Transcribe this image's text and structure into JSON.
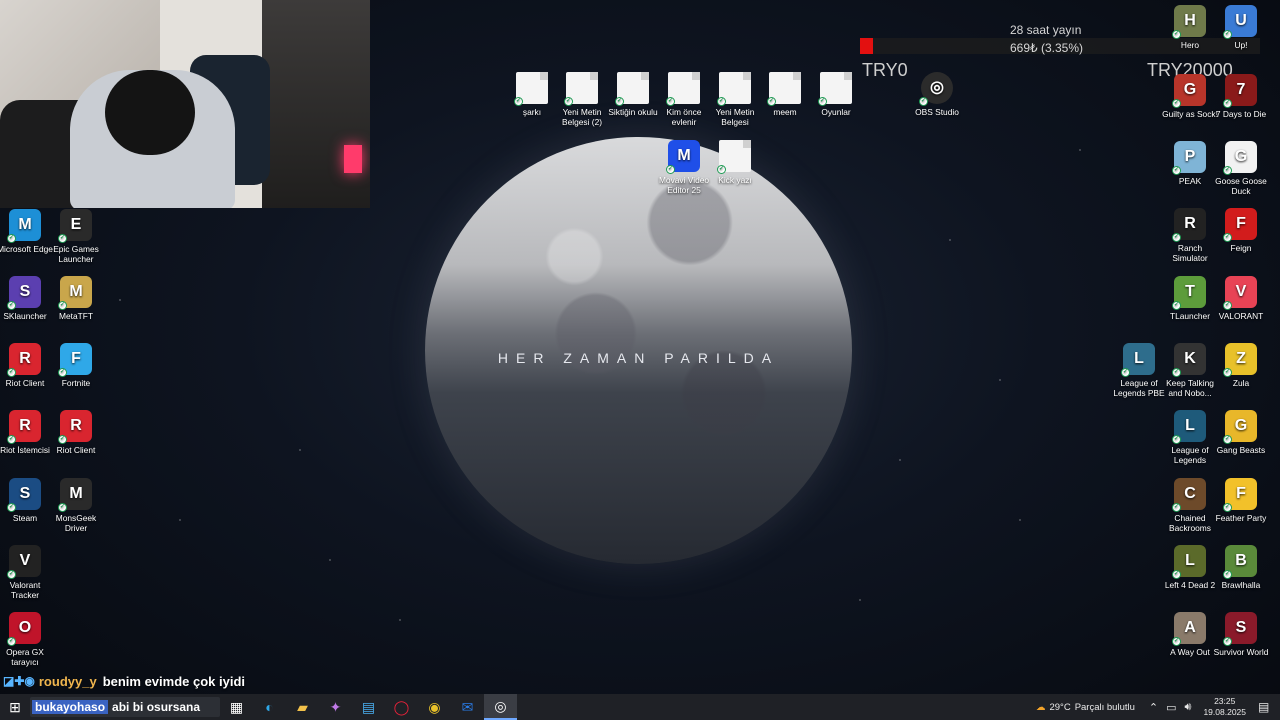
{
  "wallpaper": {
    "slogan": "HER ZAMAN PARILDA"
  },
  "overlay": {
    "subtitle": "28 saat yayın",
    "progress_text": "669₺ (3.35%)",
    "progress_fraction": 0.0335,
    "min_label": "TRY0",
    "max_label": "TRY20000",
    "bar_color": "#e31010"
  },
  "desktop": {
    "top_files": [
      {
        "label": "şarkı",
        "icon": "document-icon"
      },
      {
        "label": "Yeni Metin Belgesi (2)",
        "icon": "document-icon"
      },
      {
        "label": "Siktiğin okulu",
        "icon": "document-icon"
      },
      {
        "label": "Kim önce evlenir",
        "icon": "document-icon"
      },
      {
        "label": "Yeni Metin Belgesi",
        "icon": "document-icon"
      },
      {
        "label": "meem",
        "icon": "document-icon"
      },
      {
        "label": "Oyunlar",
        "icon": "document-icon"
      },
      {
        "label": "OBS Studio",
        "icon": "obs-icon"
      }
    ],
    "second_row_files": [
      {
        "label": "Movavi Video Editor 25",
        "icon": "movavi-icon"
      },
      {
        "label": "Kick yazı",
        "icon": "document-icon"
      }
    ],
    "left_icons": [
      {
        "label": "Microsoft Edge",
        "icon": "edge-icon",
        "color": "#1d8fd6"
      },
      {
        "label": "Epic Games Launcher",
        "icon": "epic-icon",
        "color": "#2a2a2a"
      },
      {
        "label": "SKlauncher",
        "icon": "sklauncher-icon",
        "color": "#5b3fb0"
      },
      {
        "label": "MetaTFT",
        "icon": "metatft-icon",
        "color": "#c9a64b"
      },
      {
        "label": "Riot Client",
        "icon": "riot-icon",
        "color": "#d9252f"
      },
      {
        "label": "Fortnite",
        "icon": "fortnite-icon",
        "color": "#2fa8e8"
      },
      {
        "label": "Riot İstemcisi",
        "icon": "riot-icon",
        "color": "#d9252f"
      },
      {
        "label": "Riot Client",
        "icon": "riot-icon",
        "color": "#d9252f"
      },
      {
        "label": "Steam",
        "icon": "steam-icon",
        "color": "#1b4c83"
      },
      {
        "label": "MonsGeek Driver",
        "icon": "monsgeek-icon",
        "color": "#2a2a2a"
      },
      {
        "label": "Valorant Tracker",
        "icon": "valorant-tracker-icon",
        "color": "#222"
      },
      {
        "label": "Opera GX tarayıcı",
        "icon": "opera-icon",
        "color": "#c0142a"
      }
    ],
    "right_icons": [
      {
        "label": "Hero",
        "icon": "hero-icon",
        "color": "#6f7a4a"
      },
      {
        "label": "Up!",
        "icon": "up-icon",
        "color": "#3a7bd5"
      },
      {
        "label": "Guilty as Sock!",
        "icon": "guilty-sock-icon",
        "color": "#b8352a"
      },
      {
        "label": "7 Days to Die",
        "icon": "seven-days-icon",
        "color": "#8a1a1a"
      },
      {
        "label": "PEAK",
        "icon": "peak-icon",
        "color": "#7fb4d6"
      },
      {
        "label": "Goose Goose Duck",
        "icon": "goose-icon",
        "color": "#f2f2f2"
      },
      {
        "label": "Ranch Simulator",
        "icon": "ranch-icon",
        "color": "#222"
      },
      {
        "label": "Feign",
        "icon": "feign-icon",
        "color": "#d21c1c"
      },
      {
        "label": "TLauncher",
        "icon": "tlauncher-icon",
        "color": "#5d9c3b"
      },
      {
        "label": "VALORANT",
        "icon": "valorant-icon",
        "color": "#e84355"
      },
      {
        "label": "League of Legends PBE",
        "icon": "lol-pbe-icon",
        "color": "#2e6d8c"
      },
      {
        "label": "Keep Talking and Nobo...",
        "icon": "keep-talking-icon",
        "color": "#333"
      },
      {
        "label": "Zula",
        "icon": "zula-icon",
        "color": "#e8c12a"
      },
      {
        "label": "League of Legends",
        "icon": "lol-icon",
        "color": "#1e5a7a"
      },
      {
        "label": "Gang Beasts",
        "icon": "gang-beasts-icon",
        "color": "#e8b72a"
      },
      {
        "label": "Chained Backrooms",
        "icon": "chained-icon",
        "color": "#6d4a2a"
      },
      {
        "label": "Feather Party",
        "icon": "feather-icon",
        "color": "#f2c12a"
      },
      {
        "label": "Left 4 Dead 2",
        "icon": "l4d2-icon",
        "color": "#5b6a2a"
      },
      {
        "label": "Brawlhalla",
        "icon": "brawlhalla-icon",
        "color": "#5a8a3a"
      },
      {
        "label": "A Way Out",
        "icon": "a-way-out-icon",
        "color": "#8a7a6a"
      },
      {
        "label": "Survivor World",
        "icon": "survivor-icon",
        "color": "#8a1a2a"
      }
    ]
  },
  "chat": {
    "user": "roudyy_y",
    "message": "benim evimde çok iyidi"
  },
  "taskbar": {
    "search_user": "bukayohaso",
    "search_text": "abi bi osursana",
    "weather": "29°C",
    "weather_desc": "Parçalı bulutlu",
    "time": "23:25",
    "date": "19.08.2025"
  }
}
